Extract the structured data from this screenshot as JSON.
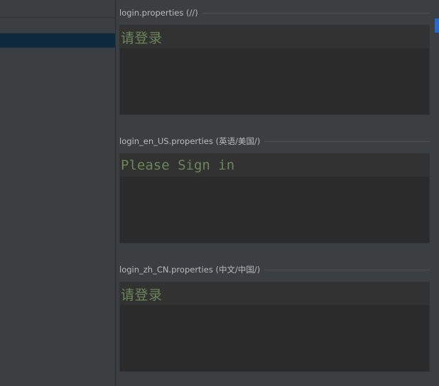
{
  "bundles": [
    {
      "file": "login.properties",
      "locale": "(//)",
      "value": "请登录"
    },
    {
      "file": "login_en_US.properties",
      "locale": "(英语/美国/)",
      "value": "Please Sign in"
    },
    {
      "file": "login_zh_CN.properties",
      "locale": "(中文/中国/)",
      "value": "请登录"
    }
  ],
  "colors": {
    "background": "#3c3f41",
    "editor_bg": "#2b2b2b",
    "current_line": "#323232",
    "string_value": "#6a8759",
    "selection": "#0d293e",
    "scroll_thumb": "#2f65ca"
  }
}
